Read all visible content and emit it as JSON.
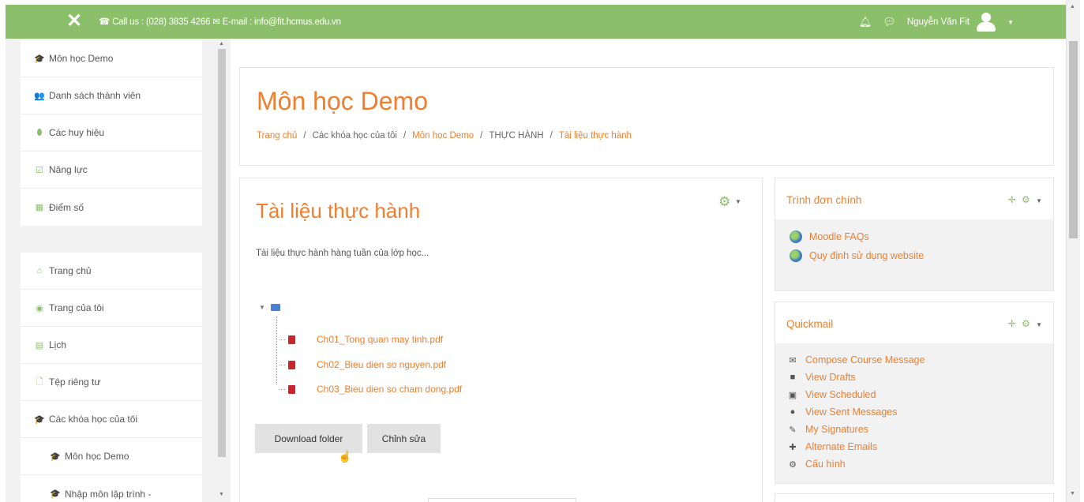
{
  "topbar": {
    "contact": "☎ Call us : (028) 3835 4266 ✉ E-mail : info@fit.hcmus.edu.vn",
    "user_name": "Nguyễn Văn Fit"
  },
  "drawer": {
    "course_items": [
      {
        "icon": "🎓",
        "label": "Môn học Demo"
      },
      {
        "icon": "👥",
        "label": "Danh sách thành viên"
      },
      {
        "icon": "⬮",
        "label": "Các huy hiệu"
      },
      {
        "icon": "☑",
        "label": "Năng lực"
      },
      {
        "icon": "▦",
        "label": "Điểm số"
      }
    ],
    "site_items": [
      {
        "icon": "⌂",
        "label": "Trang chủ"
      },
      {
        "icon": "◉",
        "label": "Trang của tôi"
      },
      {
        "icon": "▤",
        "label": "Lịch"
      },
      {
        "icon": "🗋",
        "label": "Tệp riêng tư"
      },
      {
        "icon": "🎓",
        "label": "Các khóa học của tôi"
      },
      {
        "icon": "🎓",
        "label": "Môn học Demo"
      },
      {
        "icon": "🎓",
        "label": "Nhập môn lập trình -"
      }
    ]
  },
  "header": {
    "title": "Môn học Demo",
    "breadcrumb": [
      "Trang chủ",
      "Các khóa học của tôi",
      "Môn học Demo",
      "THỰC HÀNH",
      "Tài liệu thực hành"
    ]
  },
  "main": {
    "title": "Tài liệu thực hành",
    "intro": "Tài liệu thực hành hàng tuần của lớp học...",
    "files": [
      "Ch01_Tong quan may tinh.pdf",
      "Ch02_Bieu dien so nguyen.pdf",
      "Ch03_Bieu dien so cham dong.pdf"
    ],
    "download_label": "Download folder",
    "edit_label": "Chỉnh sửa"
  },
  "blocks": {
    "main_menu": {
      "title": "Trình đơn chính",
      "links": [
        "Moodle FAQs",
        "Quy định sử dụng website"
      ]
    },
    "quickmail": {
      "title": "Quickmail",
      "items": [
        {
          "icon": "✉",
          "label": "Compose Course Message"
        },
        {
          "icon": "■",
          "label": "View Drafts"
        },
        {
          "icon": "▣",
          "label": "View Scheduled"
        },
        {
          "icon": "●",
          "label": "View Sent Messages"
        },
        {
          "icon": "✎",
          "label": "My Signatures"
        },
        {
          "icon": "✚",
          "label": "Alternate Emails"
        },
        {
          "icon": "⚙",
          "label": "Cấu hình"
        }
      ]
    }
  },
  "colors": {
    "accent": "#8cbf6a",
    "link": "#f07e2c"
  }
}
